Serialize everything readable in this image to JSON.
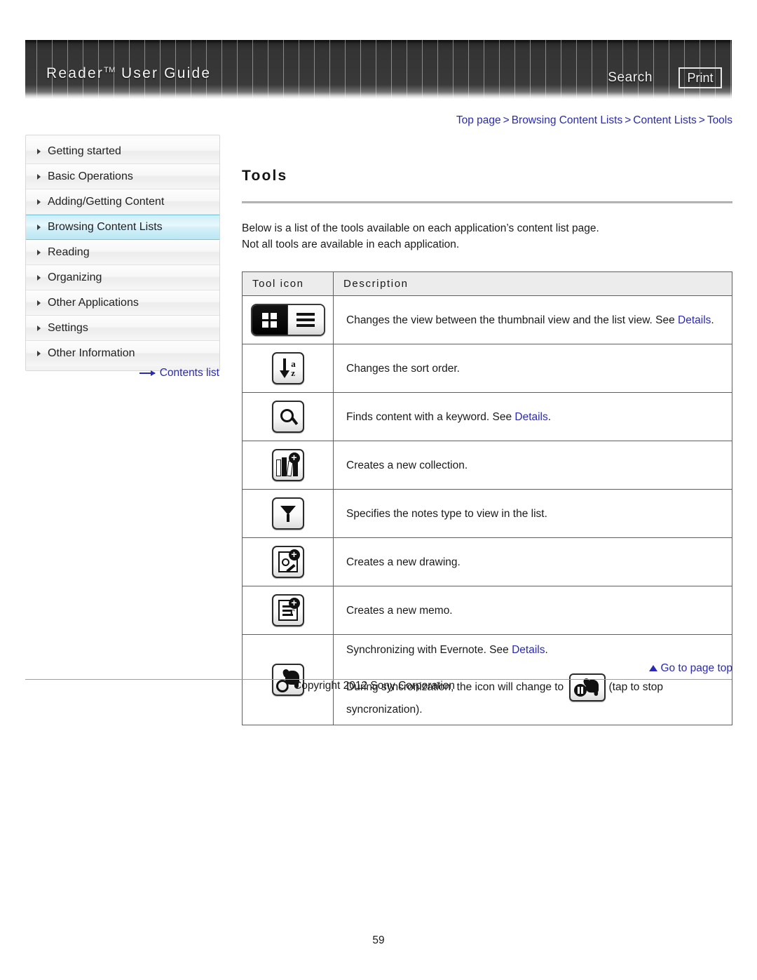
{
  "header": {
    "title": "Reader",
    "title_tm": "TM",
    "title_suffix": " User Guide",
    "search_label": "Search",
    "print_label": "Print"
  },
  "breadcrumb": {
    "items": [
      "Top page",
      "Browsing Content Lists",
      "Content Lists",
      "Tools"
    ],
    "separator": ">"
  },
  "sidebar": {
    "items": [
      {
        "label": "Getting started",
        "selected": false
      },
      {
        "label": "Basic Operations",
        "selected": false
      },
      {
        "label": "Adding/Getting Content",
        "selected": false
      },
      {
        "label": "Browsing Content Lists",
        "selected": true
      },
      {
        "label": "Reading",
        "selected": false
      },
      {
        "label": "Organizing",
        "selected": false
      },
      {
        "label": "Other Applications",
        "selected": false
      },
      {
        "label": "Settings",
        "selected": false
      },
      {
        "label": "Other Information",
        "selected": false
      }
    ],
    "contents_link": "Contents list"
  },
  "main": {
    "title": "Tools",
    "intro_line1": "Below is a list of the tools available on each application’s content list page.",
    "intro_line2": "Not all tools are available in each application.",
    "table": {
      "headers": [
        "Tool icon",
        "Description"
      ],
      "rows": [
        {
          "icon": "view-toggle-icon",
          "text_before": "Changes the view between the thumbnail view and the list view. See ",
          "link": "Details",
          "text_after": "."
        },
        {
          "icon": "sort-order-icon",
          "text_before": "Changes the sort order.",
          "link": "",
          "text_after": ""
        },
        {
          "icon": "search-icon",
          "text_before": "Finds content with a keyword. See ",
          "link": "Details",
          "text_after": "."
        },
        {
          "icon": "new-collection-icon",
          "text_before": "Creates a new collection.",
          "link": "",
          "text_after": ""
        },
        {
          "icon": "notes-filter-icon",
          "text_before": "Specifies the notes type to view in the list.",
          "link": "",
          "text_after": ""
        },
        {
          "icon": "new-drawing-icon",
          "text_before": "Creates a new drawing.",
          "link": "",
          "text_after": ""
        },
        {
          "icon": "new-memo-icon",
          "text_before": "Creates a new memo.",
          "link": "",
          "text_after": ""
        },
        {
          "icon": "evernote-sync-icon",
          "text_before": "Synchronizing with Evernote. See ",
          "link": "Details",
          "text_after": ".",
          "line2_before": "During syncronization, the icon will change to ",
          "inline_icon": "evernote-stop-sync-icon",
          "line2_after": "(tap to stop",
          "line3": "syncronization)."
        }
      ]
    }
  },
  "footer": {
    "go_to_top": "Go to page top",
    "copyright": "Copyright 2012 Sony Corporation",
    "page_number": "59"
  },
  "colors": {
    "link": "#2a2ab4",
    "selected_nav": "#b9e7f4",
    "banner_dark": "#343434",
    "table_header_bg": "#ececec"
  }
}
